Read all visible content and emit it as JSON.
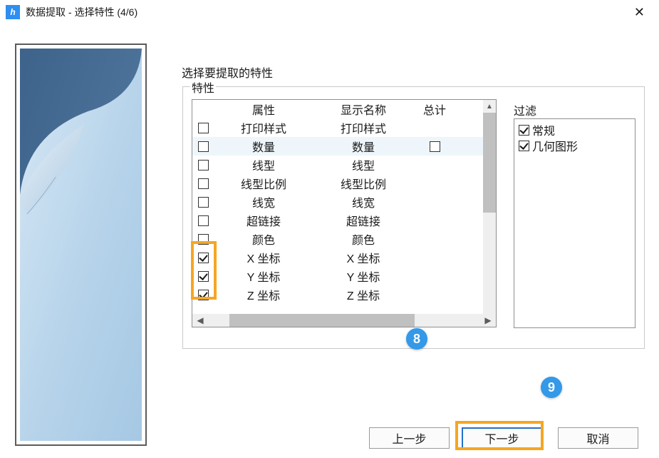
{
  "window": {
    "title": "数据提取 - 选择特性 (4/6)",
    "close_glyph": "✕"
  },
  "instruction": "选择要提取的特性",
  "group": {
    "label": "特性",
    "table": {
      "headers": {
        "col1": "属性",
        "col2": "显示名称",
        "col3": "总计"
      },
      "rows": [
        {
          "checked": false,
          "c1": "打印样式",
          "c2": "打印样式",
          "highlight": false,
          "extraBox": false
        },
        {
          "checked": false,
          "c1": "数量",
          "c2": "数量",
          "highlight": true,
          "extraBox": true
        },
        {
          "checked": false,
          "c1": "线型",
          "c2": "线型",
          "highlight": false,
          "extraBox": false
        },
        {
          "checked": false,
          "c1": "线型比例",
          "c2": "线型比例",
          "highlight": false,
          "extraBox": false
        },
        {
          "checked": false,
          "c1": "线宽",
          "c2": "线宽",
          "highlight": false,
          "extraBox": false
        },
        {
          "checked": false,
          "c1": "超链接",
          "c2": "超链接",
          "highlight": false,
          "extraBox": false
        },
        {
          "checked": false,
          "c1": "颜色",
          "c2": "颜色",
          "highlight": false,
          "extraBox": false
        },
        {
          "checked": true,
          "c1": "X 坐标",
          "c2": "X 坐标",
          "highlight": false,
          "extraBox": false
        },
        {
          "checked": true,
          "c1": "Y 坐标",
          "c2": "Y 坐标",
          "highlight": false,
          "extraBox": false
        },
        {
          "checked": true,
          "c1": "Z 坐标",
          "c2": "Z 坐标",
          "highlight": false,
          "extraBox": false
        }
      ]
    }
  },
  "filter": {
    "label": "过滤",
    "items": [
      {
        "checked": true,
        "label": "常规"
      },
      {
        "checked": true,
        "label": "几何图形"
      }
    ]
  },
  "buttons": {
    "prev": "上一步",
    "next": "下一步",
    "cancel": "取消"
  },
  "callouts": {
    "c8": "8",
    "c9": "9"
  },
  "arrows": {
    "left": "◀",
    "right": "▶",
    "up": "▲"
  }
}
